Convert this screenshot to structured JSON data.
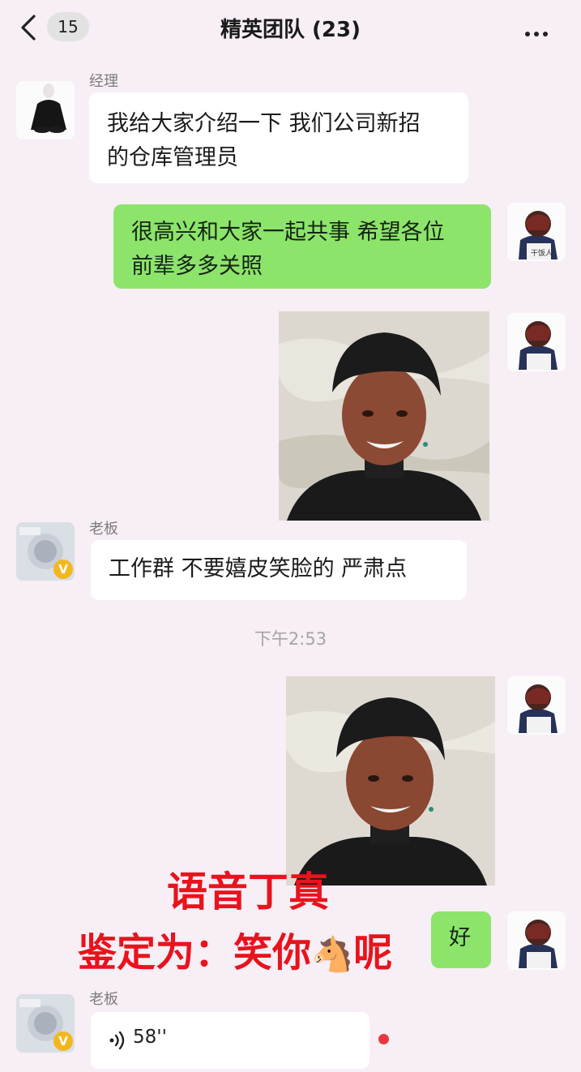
{
  "header": {
    "back_label": "<",
    "unread_count": "15",
    "title": "精英团队 (23)",
    "more_label": "..."
  },
  "messages": [
    {
      "sender": "经理",
      "text_line1": "我给大家介绍一下 我们公司新招",
      "text_line2": "的仓库管理员"
    },
    {
      "text_line1": "很高兴和大家一起共事 希望各位",
      "text_line2": "前辈多多关照"
    },
    {
      "sender": "老板",
      "text": "工作群 不要嬉皮笑脸的  严肃点"
    },
    {
      "text": "好"
    },
    {
      "sender": "老板",
      "voice_duration": "58''"
    }
  ],
  "timestamp": "下午2:53",
  "overlay": {
    "line1": "语音丁真",
    "line2_part1": "鉴定为：笑你",
    "line2_part2": "呢",
    "emoji": "🐴"
  },
  "my_avatar_text": "干饭人",
  "boss_badge": "V",
  "colors": {
    "background": "#f7eef6",
    "green_bubble": "#8de46b",
    "overlay_text": "#e8131c",
    "unread_dot": "#e8393f"
  }
}
